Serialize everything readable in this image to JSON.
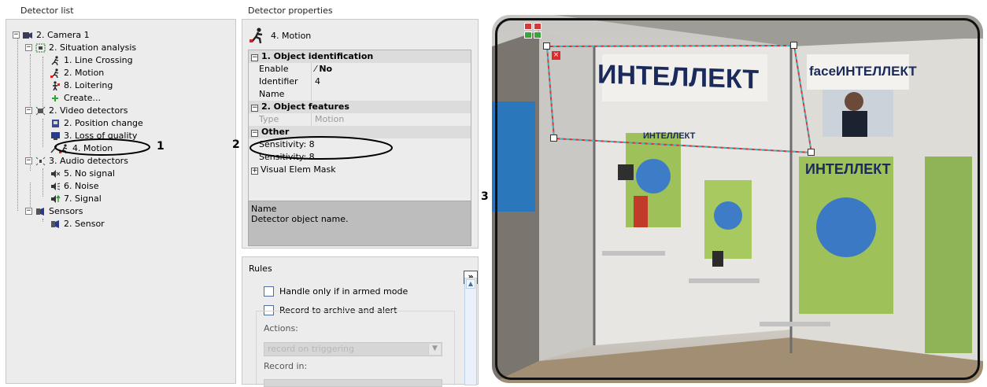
{
  "panels": {
    "tree_title": "Detector list",
    "props_title": "Detector properties",
    "rules_title": "Rules"
  },
  "tree": {
    "root": "2. Camera 1",
    "situation_group": "2. Situation analysis",
    "line_crossing": "1. Line Crossing",
    "motion_sa": "2. Motion",
    "loitering": "8. Loitering",
    "create": "Create...",
    "video_group": "2. Video detectors",
    "position_change": "2. Position change",
    "loss_quality": "3. Loss of quality",
    "motion_vd": "4. Motion",
    "audio_group": "3. Audio detectors",
    "no_signal": "5. No signal",
    "noise": "6. Noise",
    "signal": "7. Signal",
    "sensors_group": "Sensors",
    "sensor": "2. Sensor"
  },
  "props": {
    "selected": "4. Motion",
    "cat1": "1. Object identification",
    "enable_key": "Enable",
    "enable_val": "No",
    "identifier_key": "Identifier",
    "identifier_val": "4",
    "name_key": "Name",
    "cat2": "2. Object features",
    "type_key": "Type",
    "type_val": "Motion",
    "cat3": "Other",
    "sensitivity1": "Sensitivity: 8",
    "sensitivity2": "Sensitivity: 8",
    "visual_elem": "Visual Elem Mask",
    "desc_title": "Name",
    "desc_text": "Detector object name."
  },
  "rules": {
    "armed_label": "Handle only if in armed mode",
    "record_label": "Record to archive and alert",
    "actions_label": "Actions:",
    "actions_value": "record on triggering",
    "record_in_label": "Record in:",
    "expand_label": "»"
  },
  "video": {
    "wall_sign_1": "ИНТЕЛЛЕКТ",
    "wall_sign_2": "faceИНТЕЛЛЕКТ",
    "poster_right": "ИНТЕЛЛЕКТ",
    "poster_mid": "ИНТЕЛЛЕКТ"
  },
  "callouts": {
    "c1": "1",
    "c2": "2",
    "c3": "3"
  }
}
